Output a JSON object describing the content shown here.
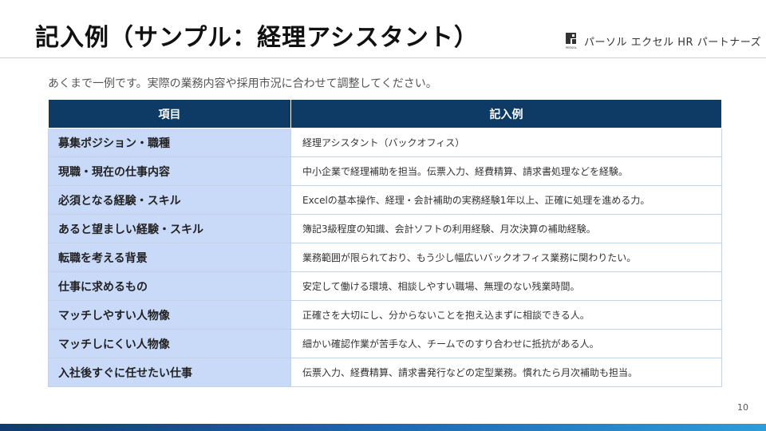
{
  "header": {
    "title": "記入例（サンプル：経理アシスタント）",
    "logo_text": "パーソル エクセル HR パートナーズ",
    "logo_mark_text": "PERSOL"
  },
  "subtitle": "あくまで一例です。実際の業務内容や採用市況に合わせて調整してください。",
  "table": {
    "columns": [
      "項目",
      "記入例"
    ],
    "rows": [
      {
        "label": "募集ポジション・職種",
        "value": "経理アシスタント（バックオフィス）"
      },
      {
        "label": "現職・現在の仕事内容",
        "value": "中小企業で経理補助を担当。伝票入力、経費精算、請求書処理などを経験。"
      },
      {
        "label": "必須となる経験・スキル",
        "value": "Excelの基本操作、経理・会計補助の実務経験1年以上、正確に処理を進める力。"
      },
      {
        "label": "あると望ましい経験・スキル",
        "value": "簿記3級程度の知識、会計ソフトの利用経験、月次決算の補助経験。"
      },
      {
        "label": "転職を考える背景",
        "value": "業務範囲が限られており、もう少し幅広いバックオフィス業務に関わりたい。"
      },
      {
        "label": "仕事に求めるもの",
        "value": "安定して働ける環境、相談しやすい職場、無理のない残業時間。"
      },
      {
        "label": "マッチしやすい人物像",
        "value": "正確さを大切にし、分からないことを抱え込まずに相談できる人。"
      },
      {
        "label": "マッチしにくい人物像",
        "value": "細かい確認作業が苦手な人、チームでのすり合わせに抵抗がある人。"
      },
      {
        "label": "入社後すぐに任せたい仕事",
        "value": "伝票入力、経費精算、請求書発行などの定型業務。慣れたら月次補助も担当。"
      }
    ]
  },
  "footer": {
    "page_number": "10"
  },
  "colors": {
    "header_bg": "#0d3b66",
    "label_bg": "#c9daf8",
    "border": "#c4d2e6",
    "footer_gradient_start": "#0f3b6e",
    "footer_gradient_end": "#2d9cdb"
  },
  "icons": {
    "logo": "persol-logo-icon"
  }
}
